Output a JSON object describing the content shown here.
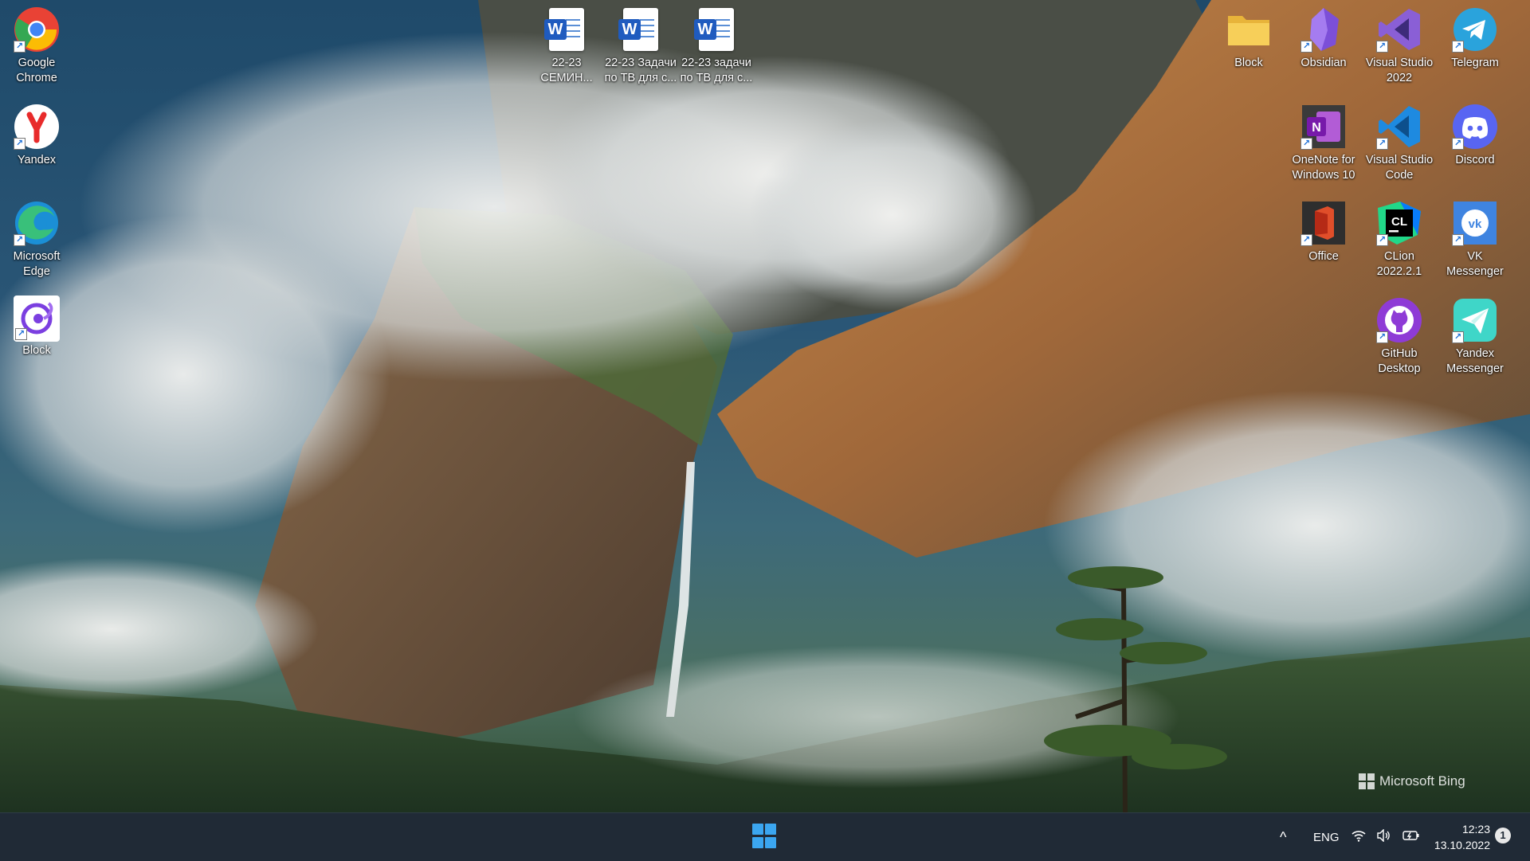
{
  "desktop_left": [
    {
      "label": "Google Chrome",
      "icon": "chrome-icon"
    },
    {
      "label": "Yandex",
      "icon": "yandex-browser-icon"
    },
    {
      "label": "Microsoft Edge",
      "icon": "edge-icon"
    },
    {
      "label": "Block",
      "icon": "block-app-icon"
    }
  ],
  "desktop_top": [
    {
      "label": "22-23 СЕМИН...",
      "icon": "word-document-icon"
    },
    {
      "label": "22-23 Задачи по ТВ для с...",
      "icon": "word-document-icon"
    },
    {
      "label": "22-23 задачи по ТВ для с...",
      "icon": "word-document-icon"
    }
  ],
  "desktop_right": [
    {
      "label": "Block",
      "icon": "folder-icon"
    },
    {
      "label": "Obsidian",
      "icon": "obsidian-icon"
    },
    {
      "label": "Visual Studio 2022",
      "icon": "visual-studio-icon"
    },
    {
      "label": "Telegram",
      "icon": "telegram-icon"
    },
    {
      "label": "OneNote for Windows 10",
      "icon": "onenote-icon"
    },
    {
      "label": "Visual Studio Code",
      "icon": "vscode-icon"
    },
    {
      "label": "Discord",
      "icon": "discord-icon"
    },
    {
      "label": "Office",
      "icon": "office-icon"
    },
    {
      "label": "CLion 2022.2.1",
      "icon": "clion-icon"
    },
    {
      "label": "VK Messenger",
      "icon": "vk-messenger-icon"
    },
    {
      "label": "GitHub Desktop",
      "icon": "github-desktop-icon"
    },
    {
      "label": "Yandex Messenger",
      "icon": "yandex-messenger-icon"
    }
  ],
  "wallpaper": {
    "watermark": "Microsoft Bing"
  },
  "taskbar": {
    "language": "ENG",
    "time": "12:23",
    "date": "13.10.2022",
    "notification_count": "1",
    "chevron": "^",
    "accent": "#3ba6f0"
  }
}
